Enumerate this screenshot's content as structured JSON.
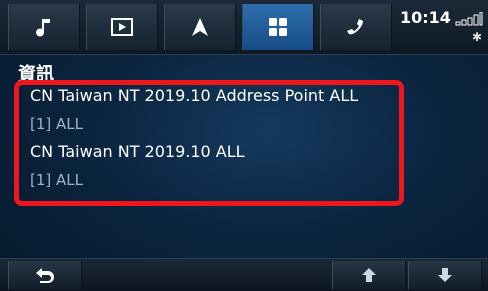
{
  "status": {
    "time": "10:14"
  },
  "topbar": {
    "tabs": [
      {
        "icon": "music-note-icon"
      },
      {
        "icon": "video-play-icon"
      },
      {
        "icon": "navigation-arrow-icon"
      },
      {
        "icon": "apps-grid-icon",
        "active": true
      },
      {
        "icon": "phone-icon"
      }
    ]
  },
  "section": {
    "title": "資訊"
  },
  "items": [
    {
      "name": "CN Taiwan NT 2019.10 Address Point ALL",
      "detail": "[1] ALL"
    },
    {
      "name": "CN Taiwan NT 2019.10 ALL",
      "detail": "[1] ALL"
    }
  ],
  "bottombar": {
    "icons": [
      "back-icon",
      "scroll-up-icon",
      "scroll-down-icon"
    ]
  },
  "colors": {
    "highlight": "#f0161c",
    "active_tab": "#2f6fae"
  }
}
